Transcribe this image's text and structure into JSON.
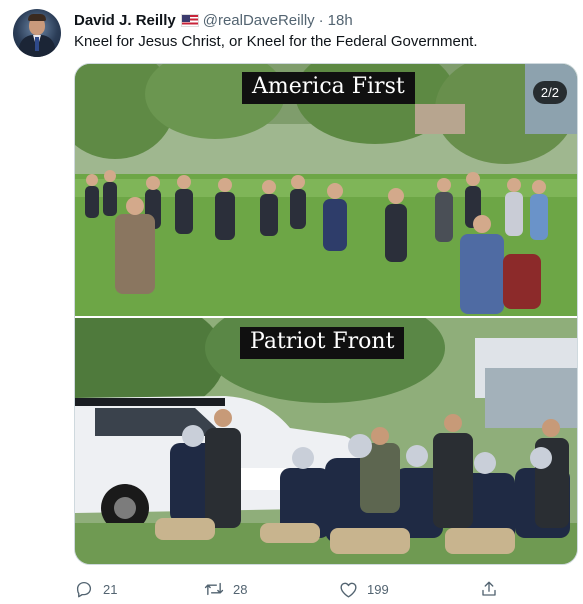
{
  "author": {
    "name": "David J. Reilly",
    "flag_icon": "us-flag-icon",
    "handle": "@realDaveReilly",
    "separator": "·",
    "time": "18h"
  },
  "tweet": {
    "text": "Kneel for Jesus Christ, or Kneel for the Federal Government."
  },
  "media": {
    "counter": "2/2",
    "top_caption": "America First",
    "bottom_caption": "Patriot Front"
  },
  "actions": {
    "replies": "21",
    "retweets": "28",
    "likes": "199"
  },
  "colors": {
    "text_primary": "#0f1419",
    "text_secondary": "#536471",
    "border": "#cfd9de"
  }
}
